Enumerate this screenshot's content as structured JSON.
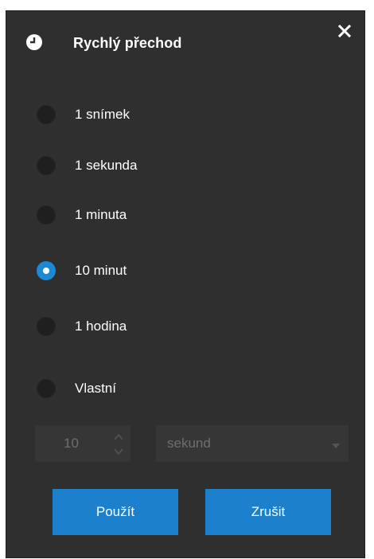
{
  "dialog": {
    "title": "Rychlý přechod",
    "icon": "clock-icon",
    "close_icon": "close-icon"
  },
  "options": [
    {
      "label": "1 snímek",
      "checked": false
    },
    {
      "label": "1 sekunda",
      "checked": false
    },
    {
      "label": "1 minuta",
      "checked": false
    },
    {
      "label": "10 minut",
      "checked": true
    },
    {
      "label": "1 hodina",
      "checked": false
    },
    {
      "label": "Vlastní",
      "checked": false
    }
  ],
  "custom": {
    "value": "10",
    "unit": "sekund"
  },
  "buttons": {
    "apply": "Použít",
    "cancel": "Zrušit"
  },
  "colors": {
    "background": "#2f2f2f",
    "accent": "#1c80cc",
    "text": "#ffffff",
    "disabled_text": "#6e6e6e"
  }
}
